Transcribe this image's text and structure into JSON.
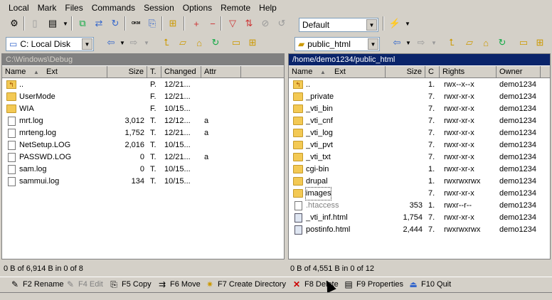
{
  "menu": [
    "Local",
    "Mark",
    "Files",
    "Commands",
    "Session",
    "Options",
    "Remote",
    "Help"
  ],
  "toolbar": {
    "profile": "Default"
  },
  "left": {
    "drive": "C: Local Disk",
    "path": "C:\\Windows\\Debug",
    "headers": {
      "name": "Name",
      "ext": "Ext",
      "size": "Size",
      "type": "T.",
      "changed": "Changed",
      "attr": "Attr"
    },
    "files": [
      {
        "name": "..",
        "size": "",
        "type": "P.",
        "changed": "12/21...",
        "attr": "",
        "icon": "up"
      },
      {
        "name": "UserMode",
        "size": "",
        "type": "F.",
        "changed": "12/21...",
        "attr": "",
        "icon": "folder"
      },
      {
        "name": "WIA",
        "size": "",
        "type": "F.",
        "changed": "10/15...",
        "attr": "",
        "icon": "folder"
      },
      {
        "name": "mrt.log",
        "size": "3,012",
        "type": "T.",
        "changed": "12/12...",
        "attr": "a",
        "icon": "file"
      },
      {
        "name": "mrteng.log",
        "size": "1,752",
        "type": "T.",
        "changed": "12/21...",
        "attr": "a",
        "icon": "file"
      },
      {
        "name": "NetSetup.LOG",
        "size": "2,016",
        "type": "T.",
        "changed": "10/15...",
        "attr": "",
        "icon": "file"
      },
      {
        "name": "PASSWD.LOG",
        "size": "0",
        "type": "T.",
        "changed": "12/21...",
        "attr": "a",
        "icon": "file"
      },
      {
        "name": "sam.log",
        "size": "0",
        "type": "T.",
        "changed": "10/15...",
        "attr": "",
        "icon": "file"
      },
      {
        "name": "sammui.log",
        "size": "134",
        "type": "T.",
        "changed": "10/15...",
        "attr": "",
        "icon": "file"
      }
    ],
    "status": "0 B of 6,914 B in 0 of 8"
  },
  "right": {
    "folder": "public_html",
    "path": "/home/demo1234/public_html",
    "headers": {
      "name": "Name",
      "ext": "Ext",
      "size": "Size",
      "c": "C",
      "rights": "Rights",
      "owner": "Owner"
    },
    "files": [
      {
        "name": "..",
        "size": "",
        "c": "1.",
        "rights": "rwx--x--x",
        "owner": "demo1234",
        "icon": "up"
      },
      {
        "name": "_private",
        "size": "",
        "c": "7.",
        "rights": "rwxr-xr-x",
        "owner": "demo1234",
        "icon": "folder"
      },
      {
        "name": "_vti_bin",
        "size": "",
        "c": "7.",
        "rights": "rwxr-xr-x",
        "owner": "demo1234",
        "icon": "folder"
      },
      {
        "name": "_vti_cnf",
        "size": "",
        "c": "7.",
        "rights": "rwxr-xr-x",
        "owner": "demo1234",
        "icon": "folder"
      },
      {
        "name": "_vti_log",
        "size": "",
        "c": "7.",
        "rights": "rwxr-xr-x",
        "owner": "demo1234",
        "icon": "folder"
      },
      {
        "name": "_vti_pvt",
        "size": "",
        "c": "7.",
        "rights": "rwxr-xr-x",
        "owner": "demo1234",
        "icon": "folder"
      },
      {
        "name": "_vti_txt",
        "size": "",
        "c": "7.",
        "rights": "rwxr-xr-x",
        "owner": "demo1234",
        "icon": "folder"
      },
      {
        "name": "cgi-bin",
        "size": "",
        "c": "1.",
        "rights": "rwxr-xr-x",
        "owner": "demo1234",
        "icon": "folder"
      },
      {
        "name": "drupal",
        "size": "",
        "c": "1.",
        "rights": "rwxrwxrwx",
        "owner": "demo1234",
        "icon": "folder"
      },
      {
        "name": "images",
        "size": "",
        "c": "7.",
        "rights": "rwxr-xr-x",
        "owner": "demo1234",
        "icon": "folder"
      },
      {
        "name": ".htaccess",
        "size": "353",
        "c": "1.",
        "rights": "rwxr--r--",
        "owner": "demo1234",
        "icon": "file"
      },
      {
        "name": "_vti_inf.html",
        "size": "1,754",
        "c": "7.",
        "rights": "rwxr-xr-x",
        "owner": "demo1234",
        "icon": "html"
      },
      {
        "name": "postinfo.html",
        "size": "2,444",
        "c": "7.",
        "rights": "rwxrwxrwx",
        "owner": "demo1234",
        "icon": "html"
      }
    ],
    "status": "0 B of 4,551 B in 0 of 12"
  },
  "fkeys": [
    {
      "label": "F2 Rename",
      "icon": "rename-icon",
      "enabled": true
    },
    {
      "label": "F4 Edit",
      "icon": "edit-icon",
      "enabled": false
    },
    {
      "label": "F5 Copy",
      "icon": "copy-icon",
      "enabled": true
    },
    {
      "label": "F6 Move",
      "icon": "move-icon",
      "enabled": true
    },
    {
      "label": "F7 Create Directory",
      "icon": "create-directory-icon",
      "enabled": true
    },
    {
      "label": "F8 Delete",
      "icon": "delete-icon",
      "enabled": true
    },
    {
      "label": "F9 Properties",
      "icon": "properties-icon",
      "enabled": true
    },
    {
      "label": "F10 Quit",
      "icon": "quit-icon",
      "enabled": true
    }
  ]
}
